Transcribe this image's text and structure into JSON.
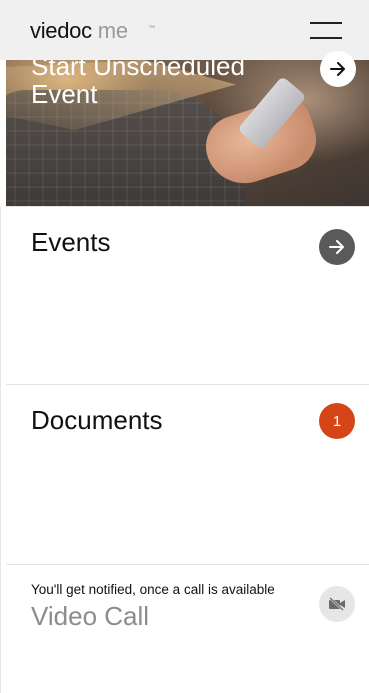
{
  "header": {
    "logo_brand": "viedoc",
    "logo_suffix": "me",
    "logo_tm": "™",
    "menu_icon": "hamburger-menu-icon"
  },
  "hero": {
    "title": "Start Unscheduled Event",
    "arrow_icon": "arrow-right-icon"
  },
  "cards": {
    "events": {
      "title": "Events",
      "icon": "arrow-right-icon"
    },
    "documents": {
      "title": "Documents",
      "badge": "1"
    },
    "video_call": {
      "note": "You'll get notified, once a call is available",
      "title": "Video Call",
      "icon": "video-off-icon"
    }
  },
  "colors": {
    "header_bg": "#f0f0f0",
    "badge": "#d64517",
    "dark_button": "#5a5a5a",
    "disabled_text": "#8c8c8c"
  }
}
